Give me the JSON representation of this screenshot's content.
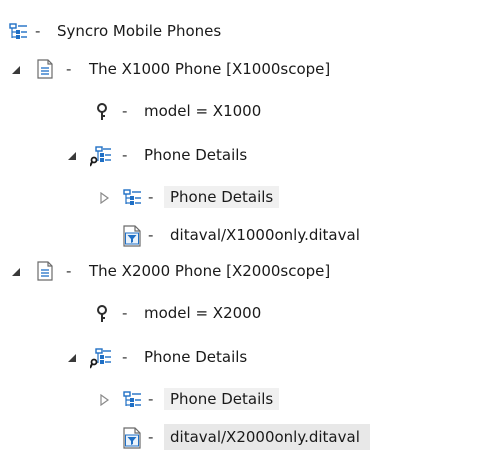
{
  "tree": {
    "root": {
      "label": "Syncro Mobile Phones",
      "icon": "ditamap-icon"
    },
    "separator": "-",
    "topics": [
      {
        "label": "The X1000 Phone [X1000scope]",
        "icon": "topic-file-icon",
        "expanded": true,
        "key": {
          "label": "model = X1000",
          "icon": "key-icon"
        },
        "group": {
          "label": "Phone Details",
          "icon": "keyscope-map-icon",
          "expanded": true,
          "child_map": {
            "label": "Phone Details",
            "icon": "ditamap-icon",
            "expanded": false
          },
          "ditaval": {
            "label": "ditaval/X1000only.ditaval",
            "icon": "ditaval-filter-icon"
          }
        }
      },
      {
        "label": "The X2000 Phone [X2000scope]",
        "icon": "topic-file-icon",
        "expanded": true,
        "key": {
          "label": "model = X2000",
          "icon": "key-icon"
        },
        "group": {
          "label": "Phone Details",
          "icon": "keyscope-map-icon",
          "expanded": true,
          "child_map": {
            "label": "Phone Details",
            "icon": "ditamap-icon",
            "expanded": false
          },
          "ditaval": {
            "label": "ditaval/X2000only.ditaval",
            "icon": "ditaval-filter-icon",
            "selected": true
          }
        }
      }
    ]
  },
  "colors": {
    "icon_blue": "#1f6fc5",
    "icon_dark": "#2d2d2d",
    "selection_bg": "#eeeeee",
    "highlight_bg": "#f0f0f0"
  }
}
